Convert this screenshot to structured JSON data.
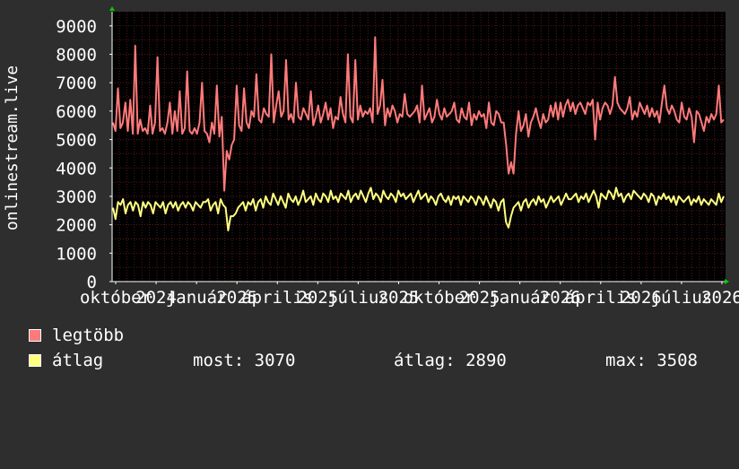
{
  "chart_data": {
    "type": "line",
    "ylabel": "onlinestream.live",
    "ylim": [
      0,
      9500
    ],
    "yticks": [
      0,
      1000,
      2000,
      3000,
      4000,
      5000,
      6000,
      7000,
      8000,
      9000
    ],
    "xticks": [
      "október",
      "2024",
      "január",
      "2025",
      "április",
      "2025",
      "július",
      "2025",
      "október",
      "2025",
      "január",
      "2026",
      "április",
      "2026",
      "július",
      "2026"
    ],
    "grid": true,
    "colors": {
      "background": "#000000",
      "grid": "#5a1a1a",
      "axis": "#ffffff",
      "arrow": "#00cc00"
    },
    "series": [
      {
        "name": "legtöbb",
        "color": "#ff7a7a",
        "values": [
          5600,
          5300,
          6800,
          5400,
          5600,
          6300,
          5300,
          6400,
          5200,
          8300,
          5200,
          5700,
          5300,
          5400,
          5200,
          6200,
          5200,
          5600,
          7900,
          5300,
          5400,
          5200,
          5600,
          6300,
          5200,
          6000,
          5300,
          6700,
          5200,
          5400,
          7400,
          5300,
          5200,
          5400,
          5200,
          5600,
          7000,
          5300,
          5200,
          4900,
          5600,
          5200,
          6900,
          5100,
          5800,
          3200,
          4600,
          4300,
          4800,
          5000,
          6900,
          5500,
          5300,
          6800,
          5600,
          5400,
          6000,
          5800,
          7300,
          5700,
          5600,
          6100,
          5900,
          5800,
          8000,
          5600,
          6200,
          6700,
          5800,
          6000,
          7800,
          5700,
          5900,
          5600,
          7000,
          5800,
          5700,
          6100,
          5900,
          5700,
          6700,
          5500,
          5800,
          6200,
          5600,
          5900,
          6300,
          5700,
          6100,
          5400,
          5800,
          5700,
          6500,
          5900,
          5600,
          8000,
          5800,
          5600,
          7800,
          5700,
          6200,
          5800,
          6000,
          5900,
          6100,
          5600,
          8600,
          5900,
          6200,
          7100,
          5500,
          6100,
          5800,
          6200,
          6000,
          5600,
          5900,
          5800,
          6600,
          5900,
          5800,
          5900,
          6000,
          6200,
          5600,
          6900,
          5700,
          5900,
          6100,
          5600,
          5800,
          6400,
          5900,
          5700,
          6100,
          5800,
          5900,
          6000,
          6300,
          5700,
          5600,
          6100,
          5800,
          5700,
          6300,
          5500,
          5900,
          5700,
          6000,
          5800,
          5900,
          5400,
          6300,
          5600,
          5500,
          6000,
          5900,
          5600,
          5600,
          4800,
          3800,
          4200,
          3800,
          5200,
          6000,
          5300,
          5500,
          5900,
          5100,
          5600,
          5800,
          6100,
          5700,
          5400,
          5900,
          5600,
          5700,
          6200,
          5800,
          6300,
          5700,
          6300,
          5800,
          6200,
          6400,
          6000,
          6300,
          5900,
          6200,
          6300,
          6100,
          5900,
          6300,
          6200,
          6400,
          5000,
          6300,
          5700,
          6100,
          6300,
          6200,
          5900,
          6200,
          7200,
          6300,
          6100,
          6000,
          5900,
          6100,
          6500,
          5700,
          6000,
          5800,
          6300,
          6100,
          5900,
          6200,
          5800,
          6100,
          5800,
          6000,
          5600,
          6300,
          6900,
          6100,
          5900,
          6200,
          6000,
          5700,
          5600,
          6300,
          5800,
          5700,
          6100,
          5800,
          4900,
          6000,
          5900,
          5600,
          5300,
          5800,
          5600,
          5900,
          5700,
          5900,
          6900,
          5600,
          5700
        ]
      },
      {
        "name": "átlag",
        "color": "#ffff80",
        "values": [
          2600,
          2200,
          2800,
          2700,
          2900,
          2400,
          2700,
          2800,
          2500,
          2800,
          2700,
          2300,
          2800,
          2600,
          2800,
          2700,
          2400,
          2800,
          2700,
          2600,
          2800,
          2400,
          2700,
          2800,
          2600,
          2800,
          2500,
          2700,
          2800,
          2600,
          2800,
          2700,
          2500,
          2800,
          2700,
          2600,
          2800,
          2800,
          2900,
          2500,
          2700,
          2800,
          2400,
          2900,
          2700,
          2600,
          1800,
          2300,
          2300,
          2400,
          2600,
          2700,
          2800,
          2500,
          2800,
          2700,
          2900,
          2500,
          2800,
          2900,
          2600,
          3000,
          2800,
          2700,
          3100,
          2900,
          2700,
          3000,
          2800,
          2600,
          3100,
          2900,
          2800,
          3000,
          2700,
          2900,
          3200,
          2800,
          2900,
          3000,
          2700,
          3100,
          2900,
          2800,
          3100,
          3000,
          2800,
          3200,
          2900,
          3000,
          2800,
          3100,
          3000,
          2900,
          3200,
          2800,
          3000,
          3100,
          2900,
          3200,
          3000,
          2800,
          3100,
          3300,
          2900,
          3100,
          3000,
          2800,
          3200,
          3000,
          2900,
          3100,
          3000,
          2800,
          3200,
          3000,
          3100,
          2900,
          3000,
          3100,
          2800,
          3000,
          3200,
          2900,
          3000,
          3100,
          2800,
          3000,
          2900,
          2700,
          3000,
          3100,
          2900,
          2800,
          3000,
          2700,
          3000,
          2900,
          3000,
          2700,
          3000,
          2900,
          2800,
          3000,
          2900,
          2700,
          3000,
          2900,
          2700,
          3000,
          2800,
          2600,
          2900,
          2800,
          2500,
          2800,
          2900,
          2100,
          1900,
          2300,
          2600,
          2700,
          2800,
          2500,
          2800,
          2900,
          2600,
          2800,
          2900,
          2700,
          3000,
          2800,
          2900,
          2600,
          2800,
          3000,
          2800,
          2900,
          3000,
          2700,
          2900,
          3100,
          2900,
          2900,
          3000,
          3100,
          2800,
          3000,
          2900,
          3100,
          2800,
          3000,
          3200,
          3000,
          2600,
          3100,
          3000,
          2900,
          3200,
          3100,
          2900,
          3300,
          3000,
          3100,
          2800,
          3000,
          3100,
          2900,
          3200,
          3100,
          3000,
          2900,
          3100,
          3000,
          2800,
          3100,
          3000,
          2700,
          3000,
          2900,
          3100,
          2900,
          3000,
          2800,
          3000,
          2700,
          3000,
          2900,
          2800,
          2900,
          3000,
          2700,
          2900,
          2800,
          3000,
          2700,
          2900,
          2800,
          2700,
          2900,
          2800,
          2700,
          3100,
          2800,
          3000
        ]
      }
    ]
  },
  "legend": {
    "max_label": "legtöbb",
    "avg_label": "átlag",
    "now_text": "most: 3070",
    "avg_text": "átlag: 2890",
    "max_text": "max: 3508"
  }
}
